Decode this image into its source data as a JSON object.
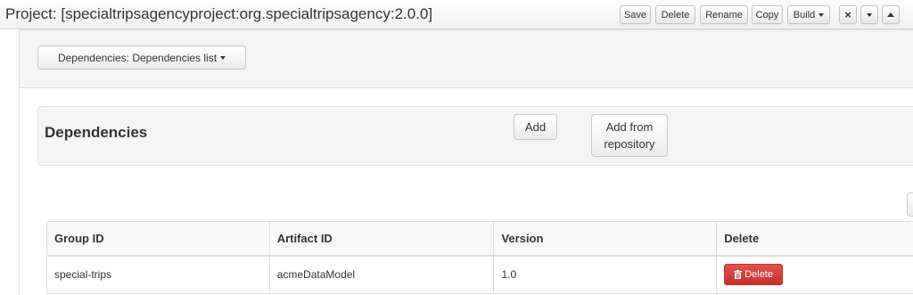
{
  "titlebar": {
    "title": "Project: [specialtripsagencyproject:org.specialtripsagency:2.0.0]",
    "buttons": {
      "save": "Save",
      "delete": "Delete",
      "rename": "Rename",
      "copy": "Copy",
      "build": "Build",
      "close_icon": "×"
    }
  },
  "selector": {
    "label": "Dependencies: Dependencies list"
  },
  "panel": {
    "title": "Dependencies",
    "add_label": "Add",
    "add_from_repo_line1": "Add from",
    "add_from_repo_line2": "repository"
  },
  "table": {
    "headers": [
      "Group ID",
      "Artifact ID",
      "Version",
      "Delete"
    ],
    "rows": [
      {
        "group_id": "special-trips",
        "artifact_id": "acmeDataModel",
        "version": "1.0",
        "delete_label": "Delete"
      }
    ]
  },
  "colors": {
    "danger": "#d9534f",
    "panel_bg": "#f5f5f5"
  },
  "icons": [
    "close-icon",
    "caret-down-icon",
    "chevron-up-icon",
    "trash-icon"
  ]
}
